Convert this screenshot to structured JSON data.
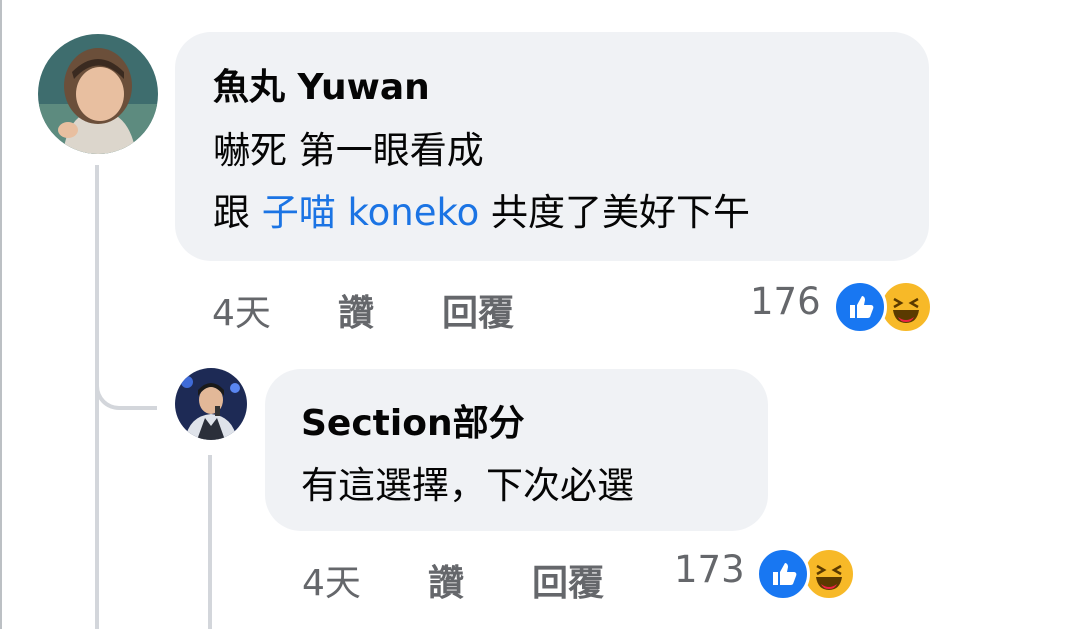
{
  "comments": [
    {
      "author": "魚丸 Yuwan",
      "line1": "嚇死 第一眼看成",
      "line2_prefix": "跟 ",
      "mention": "子喵 koneko",
      "line2_suffix": " 共度了美好下午",
      "time": "4天",
      "like_label": "讚",
      "reply_label": "回覆",
      "reaction_count": "176",
      "reactions": [
        "like-icon",
        "haha-icon"
      ]
    },
    {
      "author": "Section部分",
      "text": "有這選擇，下次必選",
      "time": "4天",
      "like_label": "讚",
      "reply_label": "回覆",
      "reaction_count": "173",
      "reactions": [
        "like-icon",
        "haha-icon"
      ]
    }
  ],
  "colors": {
    "like": "#1877f2",
    "haha": "#f7b928",
    "mention": "#1b74e4",
    "bubble": "#f0f2f5"
  }
}
